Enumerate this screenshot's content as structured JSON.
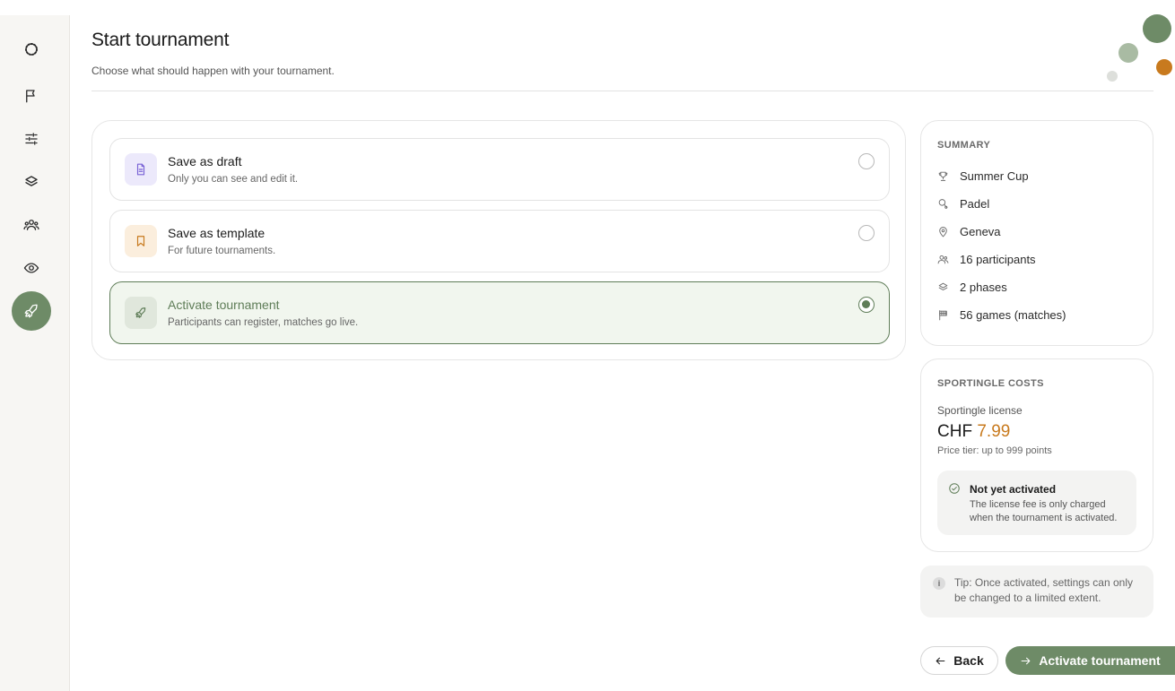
{
  "colors": {
    "accent": "#6e8b67",
    "accent_dark": "#5f7d58",
    "price": "#c87a1e",
    "draft_icon_bg": "#ece9fb",
    "template_icon_bg": "#fbeedd"
  },
  "sidebar": {
    "items": [
      {
        "icon": "logo-icon"
      },
      {
        "icon": "flag-icon"
      },
      {
        "icon": "sliders-icon"
      },
      {
        "icon": "layers-icon"
      },
      {
        "icon": "users-icon"
      },
      {
        "icon": "eye-icon"
      },
      {
        "icon": "rocket-icon",
        "active": true
      }
    ]
  },
  "header": {
    "title": "Start tournament",
    "subtitle": "Choose what should happen with your tournament."
  },
  "options": [
    {
      "title": "Save as draft",
      "description": "Only you can see and edit it.",
      "selected": false,
      "icon": "document-icon"
    },
    {
      "title": "Save as template",
      "description": "For future tournaments.",
      "selected": false,
      "icon": "bookmark-icon"
    },
    {
      "title": "Activate tournament",
      "description": "Participants can register, matches go live.",
      "selected": true,
      "icon": "rocket-icon"
    }
  ],
  "summary": {
    "heading": "SUMMARY",
    "items": [
      {
        "icon": "trophy-icon",
        "text": "Summer Cup"
      },
      {
        "icon": "racket-icon",
        "text": "Padel"
      },
      {
        "icon": "location-pin-icon",
        "text": "Geneva"
      },
      {
        "icon": "users-icon",
        "text": "16 participants"
      },
      {
        "icon": "layers-icon",
        "text": "2 phases"
      },
      {
        "icon": "checkered-flag-icon",
        "text": "56 games (matches)"
      }
    ]
  },
  "costs": {
    "heading": "SPORTINGLE COSTS",
    "license_label": "Sportingle license",
    "currency": "CHF",
    "amount": "7.99",
    "tier": "Price tier: up to 999 points",
    "status_title": "Not yet activated",
    "status_description": "The license fee is only charged when the tournament is activated."
  },
  "tip": {
    "icon_glyph": "i",
    "text": "Tip: Once activated, settings can only be changed to a limited extent."
  },
  "footer": {
    "back_label": "Back",
    "activate_label": "Activate tournament"
  }
}
